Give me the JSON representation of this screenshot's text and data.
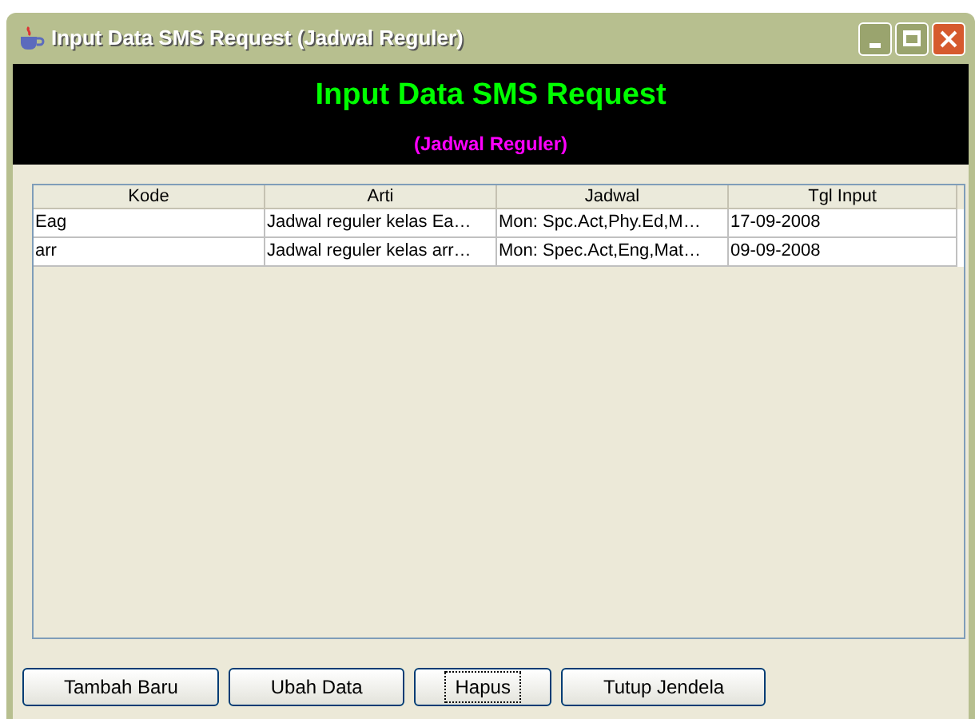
{
  "window": {
    "title": "Input Data SMS Request (Jadwal Reguler)"
  },
  "header": {
    "title": "Input Data SMS Request",
    "subtitle": "(Jadwal Reguler)"
  },
  "table": {
    "columns": [
      "Kode",
      "Arti",
      "Jadwal",
      "Tgl Input"
    ],
    "rows": [
      [
        "Eag",
        "Jadwal reguler kelas Ea…",
        "Mon: Spc.Act,Phy.Ed,M…",
        "17-09-2008"
      ],
      [
        "arr",
        "Jadwal reguler kelas arr…",
        "Mon: Spec.Act,Eng,Mat…",
        "09-09-2008"
      ]
    ]
  },
  "buttons": [
    {
      "label": "Tambah Baru",
      "focused": false
    },
    {
      "label": "Ubah Data",
      "focused": false
    },
    {
      "label": "Hapus",
      "focused": true
    },
    {
      "label": "Tutup Jendela",
      "focused": false
    }
  ]
}
